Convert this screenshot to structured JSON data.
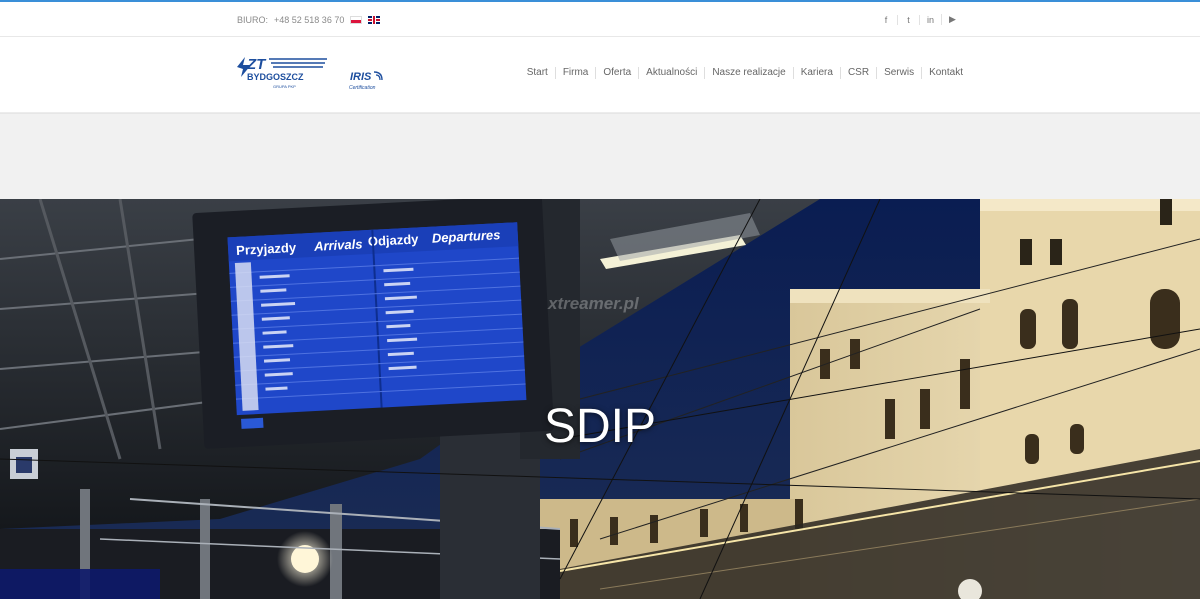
{
  "topbar": {
    "office_label": "BIURO:",
    "phone": "+48 52 518 36 70",
    "languages": [
      "pl",
      "en"
    ],
    "social": [
      {
        "icon": "facebook-icon",
        "glyph": "f"
      },
      {
        "icon": "twitter-icon",
        "glyph": "t"
      },
      {
        "icon": "linkedin-icon",
        "glyph": "in"
      },
      {
        "icon": "youtube-icon",
        "glyph": "▶"
      }
    ]
  },
  "header": {
    "logo_main": "ZT",
    "logo_city": "BYDGOSZCZ",
    "logo_group": "GRUPA PKP",
    "iris_title": "IRIS",
    "iris_sub": "Certification"
  },
  "nav": {
    "items": [
      "Start",
      "Firma",
      "Oferta",
      "Aktualności",
      "Nasze realizacje",
      "Kariera",
      "CSR",
      "Serwis",
      "Kontakt"
    ]
  },
  "hero": {
    "title": "SDIP",
    "board_arrivals_pl": "Przyjazdy",
    "board_arrivals_en": "Arrivals",
    "board_departures_pl": "Odjazdy",
    "board_departures_en": "Departures",
    "watermark": "xtreamer.pl"
  },
  "colors": {
    "accent": "#3a8fd8",
    "logo_blue": "#1d4e9e",
    "board_blue": "#1f47c9"
  }
}
